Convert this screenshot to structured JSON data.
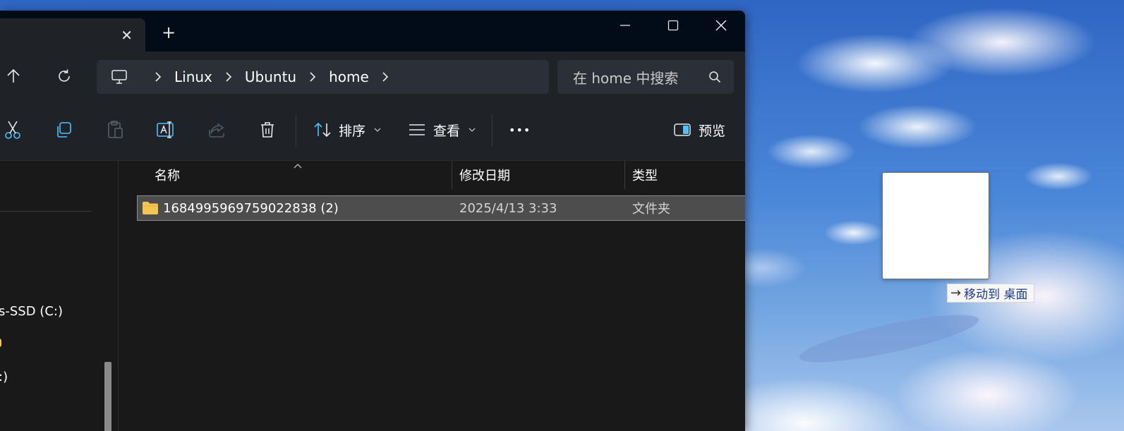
{
  "window": {
    "tab_close_glyph": "✕",
    "new_tab_glyph": "+"
  },
  "navigation": {
    "breadcrumbs": [
      "Linux",
      "Ubuntu",
      "home"
    ],
    "search_placeholder": "在 home 中搜索"
  },
  "toolbar": {
    "sort_label": "排序",
    "view_label": "查看",
    "more_label": "•••",
    "preview_label": "预览"
  },
  "nav_pane": {
    "items": [
      "s-SSD (C:)",
      ":)"
    ]
  },
  "file_list": {
    "columns": [
      "名称",
      "修改日期",
      "类型"
    ],
    "rows": [
      {
        "name": "1684995969759022838 (2)",
        "modified": "2025/4/13 3:33",
        "type": "文件夹"
      }
    ]
  },
  "drag": {
    "tooltip_arrow": "→",
    "tooltip_label": "移动到 桌面"
  },
  "colors": {
    "accent": "#4cc2ff",
    "folder": "#f5c64f",
    "window_bg": "#191919",
    "selection": "#4d4d4d"
  }
}
